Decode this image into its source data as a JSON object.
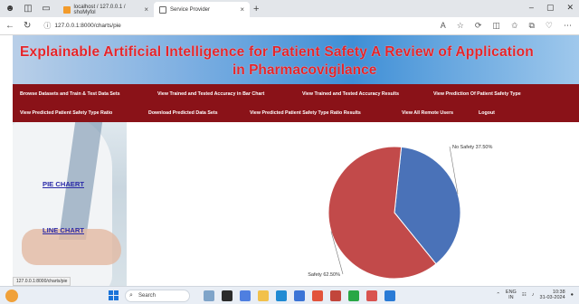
{
  "browser": {
    "tabs": [
      {
        "label": "localhost / 127.0.0.1 / shoMyfol",
        "active": false
      },
      {
        "label": "Service Provider",
        "active": true
      }
    ],
    "url": "127.0.0.1:8000/charts/pie"
  },
  "banner": {
    "title_line1": "Explainable Artificial Intelligence for Patient Safety A Review of Application",
    "title_line2": "in Pharmacovigilance"
  },
  "menu": {
    "row1": [
      "Browse Datasets and Train & Test Data Sets",
      "View Trained and Tested Accuracy in Bar Chart",
      "View Trained and Tested Accuracy Results",
      "View Prediction Of Patient Safety Type"
    ],
    "row2": [
      "View Predicted Patient Safety Type Ratio",
      "Download Predicted Data Sets",
      "View Predicted Patient Safety Type Ratio Results",
      "View All Remote Users",
      "Logout"
    ]
  },
  "side": {
    "pie_link": "PIE CHAERT",
    "line_link": "LINE CHART",
    "status_url": "127.0.0.1:8000/charts/pie"
  },
  "chart_data": {
    "type": "pie",
    "categories": [
      "No Safety",
      "Safety"
    ],
    "values": [
      37.5,
      62.5
    ],
    "labels": [
      "No Safety 37.50%",
      "Safety 62.50%"
    ],
    "colors": [
      "#4a72b8",
      "#c24a4a"
    ]
  },
  "taskbar": {
    "search_placeholder": "Search",
    "lang": "ENG",
    "region": "IN",
    "time": "10:38",
    "date": "31-03-2024"
  },
  "icons": [
    "back-icon",
    "refresh-icon",
    "search-icon",
    "windows-start-icon",
    "close-icon"
  ]
}
